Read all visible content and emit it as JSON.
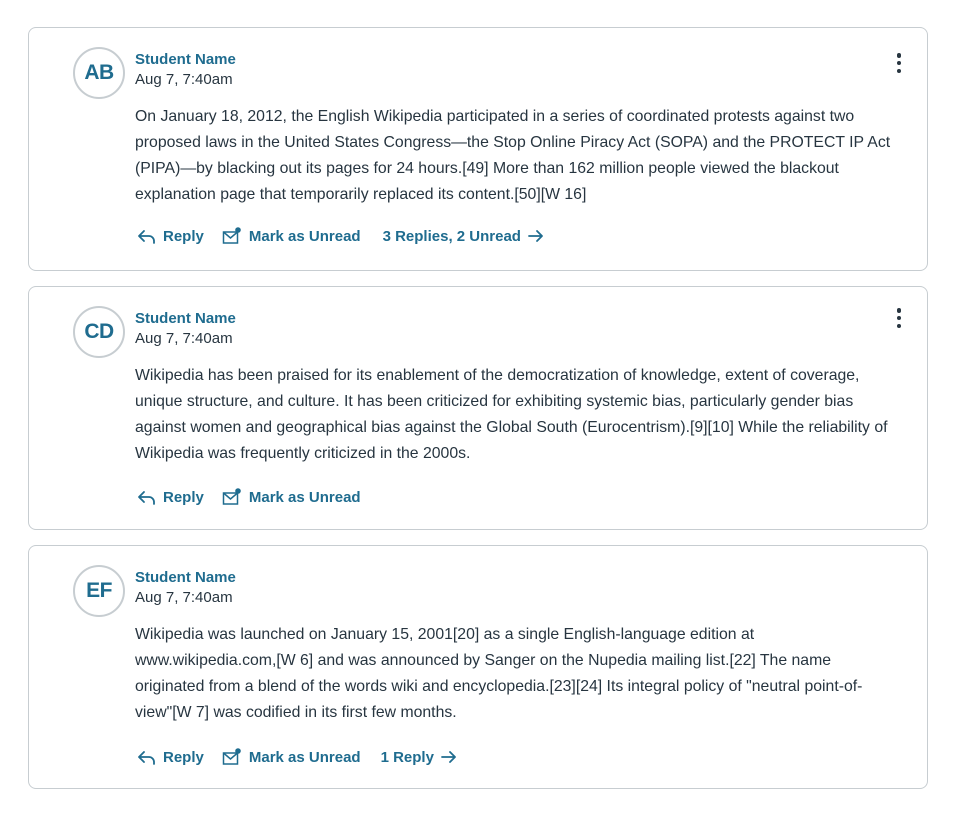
{
  "colors": {
    "accent": "#1f6c8f",
    "text": "#273540",
    "border": "#c7cdd1"
  },
  "posts": [
    {
      "initials": "AB",
      "author": "Student Name",
      "timestamp": "Aug 7, 7:40am",
      "body": "On January 18, 2012, the English Wikipedia participated in a series of coordinated protests against two proposed laws in the United States Congress—the Stop Online Piracy Act (SOPA) and the PROTECT IP Act (PIPA)—by blacking out its pages for 24 hours.[49] More than 162 million people viewed the blackout explanation page that temporarily replaced its content.[50][W 16]",
      "reply_label": "Reply",
      "unread_label": "Mark as Unread",
      "replies_label": "3 Replies, 2 Unread"
    },
    {
      "initials": "CD",
      "author": "Student Name",
      "timestamp": "Aug 7, 7:40am",
      "body": "Wikipedia has been praised for its enablement of the democratization of knowledge, extent of coverage, unique structure, and culture. It has been criticized for exhibiting systemic bias, particularly gender bias against women and geographical bias against the Global South (Eurocentrism).[9][10] While the reliability of Wikipedia was frequently criticized in the 2000s.",
      "reply_label": "Reply",
      "unread_label": "Mark as Unread"
    },
    {
      "initials": "EF",
      "author": "Student Name",
      "timestamp": "Aug 7, 7:40am",
      "body": "Wikipedia was launched on January 15, 2001[20] as a single English-language edition at www.wikipedia.com,[W 6] and was announced by Sanger on the Nupedia mailing list.[22] The name originated from a blend of the words wiki and encyclopedia.[23][24] Its integral policy of \"neutral point-of-view\"[W 7] was codified in its first few months.",
      "reply_label": "Reply",
      "unread_label": "Mark as Unread",
      "replies_label": "1 Reply"
    }
  ]
}
